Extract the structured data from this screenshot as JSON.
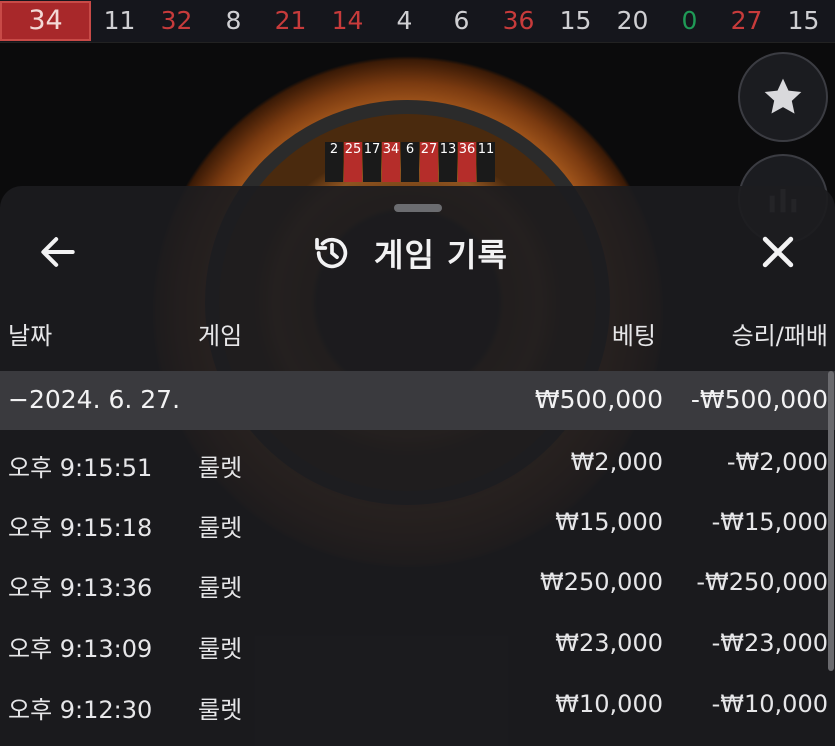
{
  "results_strip": [
    {
      "num": "34",
      "color": "red",
      "latest": true
    },
    {
      "num": "11",
      "color": "black"
    },
    {
      "num": "32",
      "color": "red"
    },
    {
      "num": "8",
      "color": "black"
    },
    {
      "num": "21",
      "color": "red"
    },
    {
      "num": "14",
      "color": "red"
    },
    {
      "num": "4",
      "color": "black"
    },
    {
      "num": "6",
      "color": "black"
    },
    {
      "num": "36",
      "color": "red"
    },
    {
      "num": "15",
      "color": "black"
    },
    {
      "num": "20",
      "color": "black"
    },
    {
      "num": "0",
      "color": "green"
    },
    {
      "num": "27",
      "color": "red"
    },
    {
      "num": "15",
      "color": "black"
    }
  ],
  "wheel_numbers": [
    "2",
    "25",
    "17",
    "34",
    "6",
    "27",
    "13",
    "36",
    "11"
  ],
  "side_buttons": {
    "favorite_icon": "star-icon",
    "stats_icon": "bar-chart-icon"
  },
  "sheet": {
    "title": "게임 기록",
    "history_icon": "history-icon",
    "back_icon": "arrow-left-icon",
    "close_icon": "close-icon",
    "columns": {
      "date": "날짜",
      "game": "게임",
      "bet": "베팅",
      "win_loss": "승리/패배"
    },
    "summary": {
      "date": "−2024. 6. 27.",
      "bet": "₩500,000",
      "win_loss": "-₩500,000"
    },
    "rows": [
      {
        "time": "오후 9:15:51",
        "game": "룰렛",
        "bet": "₩2,000",
        "win_loss": "-₩2,000"
      },
      {
        "time": "오후 9:15:18",
        "game": "룰렛",
        "bet": "₩15,000",
        "win_loss": "-₩15,000"
      },
      {
        "time": "오후 9:13:36",
        "game": "룰렛",
        "bet": "₩250,000",
        "win_loss": "-₩250,000"
      },
      {
        "time": "오후 9:13:09",
        "game": "룰렛",
        "bet": "₩23,000",
        "win_loss": "-₩23,000"
      },
      {
        "time": "오후 9:12:30",
        "game": "룰렛",
        "bet": "₩10,000",
        "win_loss": "-₩10,000"
      }
    ]
  },
  "colors": {
    "red": "#c73b3b",
    "green": "#1f9a56",
    "latest_bg": "#a8282a"
  }
}
